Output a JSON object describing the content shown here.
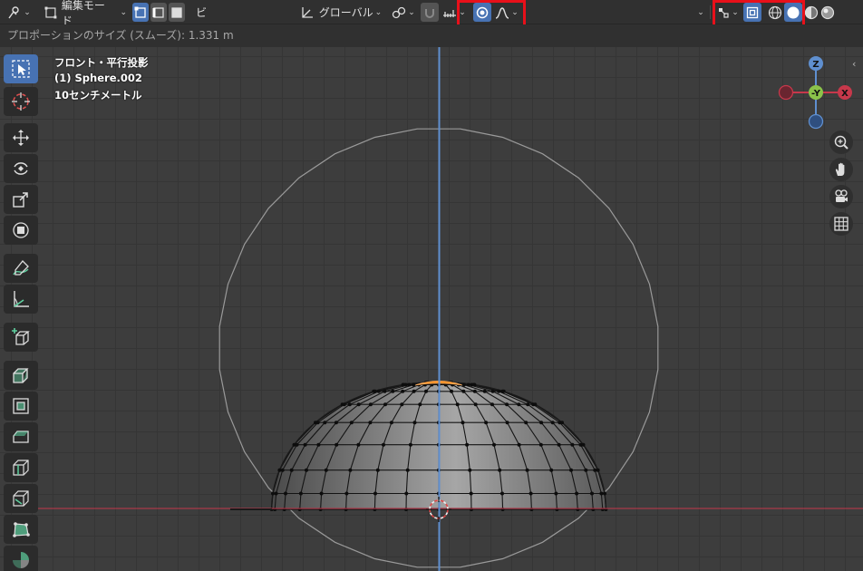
{
  "header": {
    "mode_label": "編集モード",
    "view_menu_label": "ビ",
    "orientation_label": "グローバル"
  },
  "infobar": {
    "text": "プロポーションのサイズ (スムーズ): 1.331 m"
  },
  "viewport_overlay": {
    "view_name": "フロント・平行投影",
    "object_name": "(1) Sphere.002",
    "scale_label": "10センチメートル"
  },
  "gizmo": {
    "z_label": "Z",
    "y_label": "-Y",
    "x_label": "X"
  },
  "toolbar": {
    "tools": [
      "select-box",
      "cursor",
      "move",
      "rotate",
      "scale",
      "transform",
      "annotate",
      "measure",
      "add-cube",
      "extrude-region",
      "inset-faces",
      "bevel",
      "loop-cut",
      "knife",
      "poly-build",
      "spin"
    ],
    "active_tool": "select-box"
  },
  "colors": {
    "accent": "#4772b3",
    "highlight_box": "#e8101a",
    "selected_vertices": "#ff8a1a",
    "z_axis": "#5f8fcf",
    "x_axis": "#c7384b",
    "y_axis": "#8bc34a"
  }
}
